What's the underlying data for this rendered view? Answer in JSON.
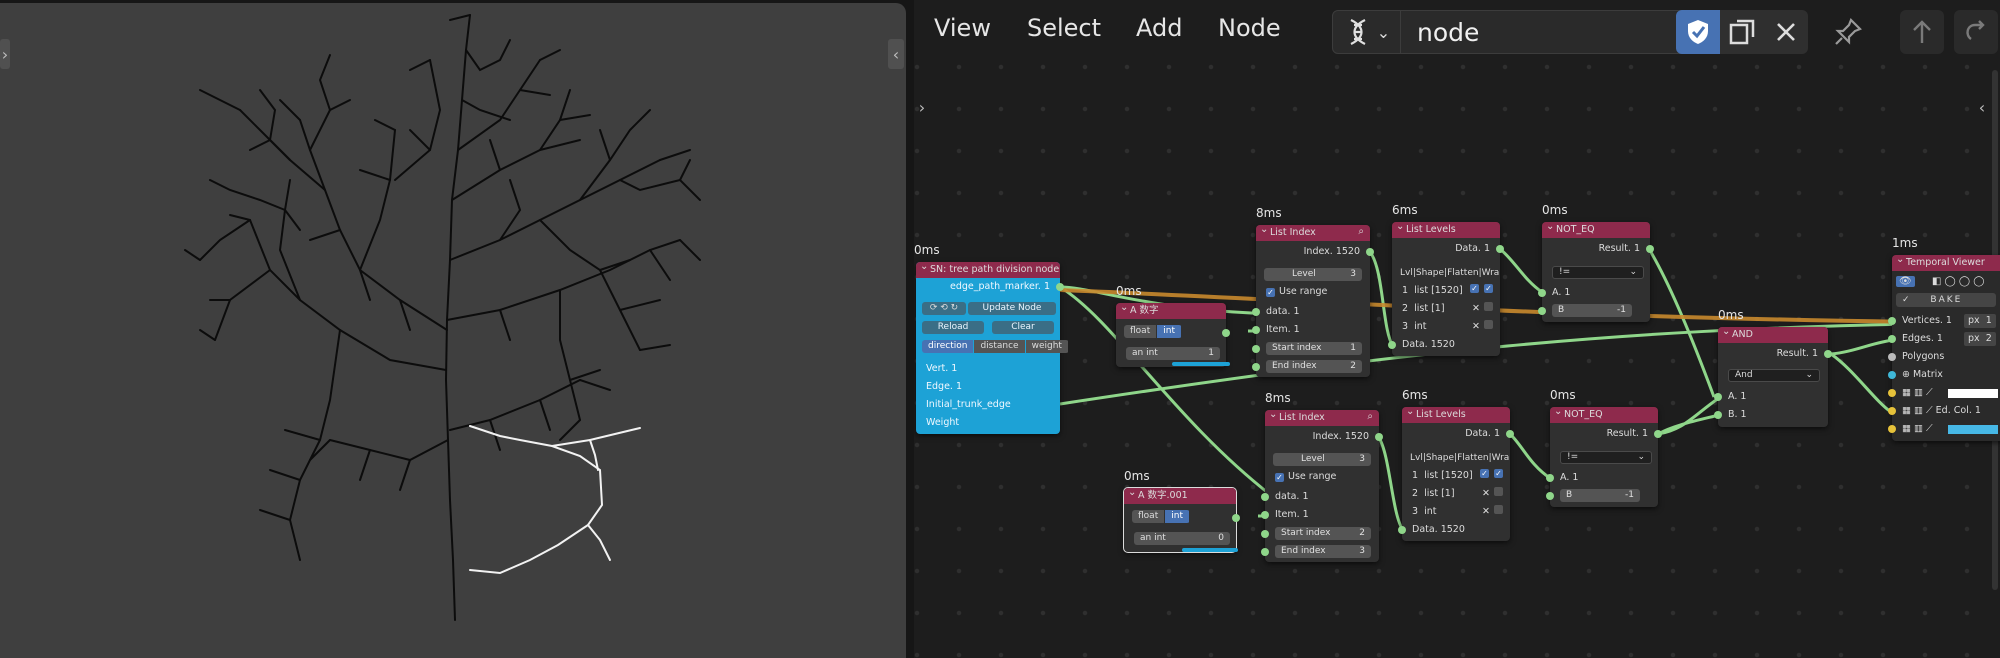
{
  "menu": {
    "view": "View",
    "select": "Select",
    "add": "Add",
    "node": "Node"
  },
  "search": {
    "value": "node"
  },
  "colors": {
    "node_header": "#8e2a4c",
    "sn_body": "#1da2d6",
    "link": "#8fd68a",
    "link_orange": "#c98a2e",
    "accent": "#4772b3"
  },
  "nodes": {
    "sn": {
      "timing": "0ms",
      "title": "SN: tree path division node",
      "out_marker": "edge_path_marker. 1",
      "update": "Update Node",
      "reload": "Reload",
      "clear": "Clear",
      "modes": [
        "direction",
        "distance",
        "weight"
      ],
      "vert": "Vert. 1",
      "edge": "Edge. 1",
      "initial": "Initial_trunk_edge",
      "weight": "Weight"
    },
    "num1": {
      "timing": "0ms",
      "title": "A 数字",
      "float": "float",
      "int": "int",
      "label": "an int",
      "value": "1"
    },
    "num2": {
      "timing": "0ms",
      "title": "A 数字.001",
      "float": "float",
      "int": "int",
      "label": "an int",
      "value": "0"
    },
    "li1": {
      "timing": "8ms",
      "title": "List Index",
      "out": "Index. 1520",
      "level_label": "Level",
      "level": "3",
      "use_range": "Use range",
      "data": "data. 1",
      "item": "Item. 1",
      "start_label": "Start index",
      "start": "1",
      "end_label": "End index",
      "end": "2"
    },
    "li2": {
      "timing": "8ms",
      "title": "List Index",
      "out": "Index. 1520",
      "level_label": "Level",
      "level": "3",
      "use_range": "Use range",
      "data": "data. 1",
      "item": "Item. 1",
      "start_label": "Start index",
      "start": "2",
      "end_label": "End index",
      "end": "3"
    },
    "ll1": {
      "timing": "6ms",
      "title": "List Levels",
      "out": "Data. 1",
      "header": "Lvl|Shape|Flatten|Wra",
      "rows": [
        [
          "1",
          "list [1520]"
        ],
        [
          "2",
          "list [1]"
        ],
        [
          "3",
          "int"
        ]
      ],
      "data": "Data. 1520"
    },
    "ll2": {
      "timing": "6ms",
      "title": "List Levels",
      "out": "Data. 1",
      "header": "Lvl|Shape|Flatten|Wra",
      "rows": [
        [
          "1",
          "list [1520]"
        ],
        [
          "2",
          "list [1]"
        ],
        [
          "3",
          "int"
        ]
      ],
      "data": "Data. 1520"
    },
    "ne1": {
      "timing": "0ms",
      "title": "NOT_EQ",
      "out": "Result. 1",
      "op": "!=",
      "a": "A. 1",
      "b": "B",
      "bval": "-1"
    },
    "ne2": {
      "timing": "0ms",
      "title": "NOT_EQ",
      "out": "Result. 1",
      "op": "!=",
      "a": "A. 1",
      "b": "B",
      "bval": "-1"
    },
    "and": {
      "timing": "0ms",
      "title": "AND",
      "out": "Result. 1",
      "op": "And",
      "a": "A. 1",
      "b": "B. 1"
    },
    "tv": {
      "timing": "1ms",
      "title": "Temporal Viewer",
      "bake": "BAKE",
      "vertices": "Vertices. 1",
      "edges": "Edges. 1",
      "polygons": "Polygons",
      "matrix": "Matrix",
      "px": "px",
      "v1": "1",
      "v2": "2",
      "edcol": "Ed. Col. 1"
    }
  }
}
